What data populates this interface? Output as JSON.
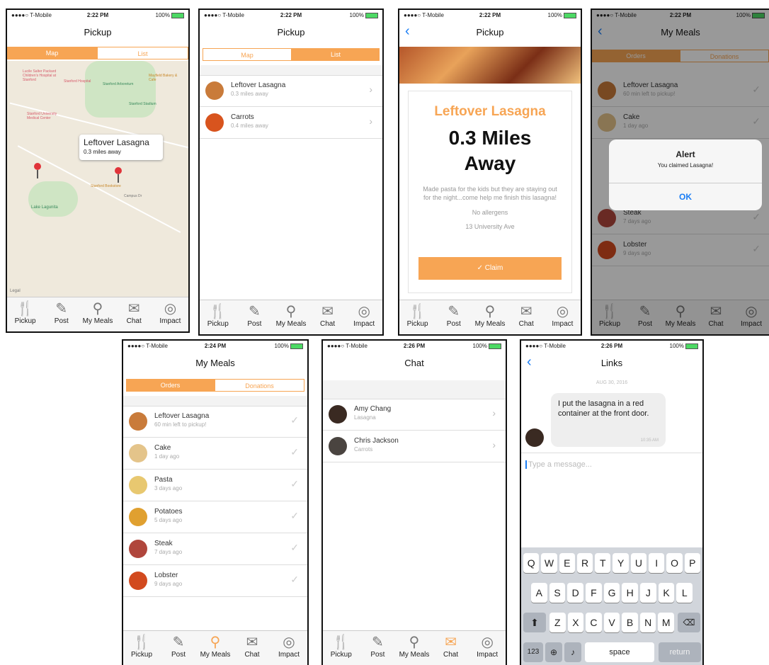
{
  "status": {
    "carrier": "●●●●○ T-Mobile",
    "battery": "100%"
  },
  "tabs": [
    "Pickup",
    "Post",
    "My Meals",
    "Chat",
    "Impact"
  ],
  "s1": {
    "time": "2:22 PM",
    "title": "Pickup",
    "seg_map": "Map",
    "seg_list": "List",
    "popup_title": "Leftover Lasagna",
    "popup_sub": "0.3 miles away",
    "labels": [
      "Lucile Salter Packard Children's Hospital at Stanford",
      "Stanford Hospital",
      "Stanford Arboretum",
      "Stanford Stadium",
      "Stanford University Medical Center",
      "Stanford Bookstore",
      "Lake Lagunita",
      "Mayfield Bakery & Cafe",
      "Campus Dr",
      "Legal"
    ]
  },
  "s2": {
    "time": "2:22 PM",
    "title": "Pickup",
    "seg_map": "Map",
    "seg_list": "List",
    "items": [
      {
        "name": "Leftover Lasagna",
        "sub": "0.3 miles away"
      },
      {
        "name": "Carrots",
        "sub": "0.4 miles away"
      }
    ]
  },
  "s3": {
    "time": "2:22 PM",
    "title": "Pickup",
    "dish": "Leftover Lasagna",
    "distance_line1": "0.3 Miles",
    "distance_line2": "Away",
    "desc": "Made pasta for the kids but they are staying out for the night...come help me finish this lasagna!",
    "allergens": "No allergens",
    "address": "13 University Ave",
    "claim": "✓ Claim"
  },
  "s4": {
    "time": "2:22 PM",
    "title": "My Meals",
    "seg_a": "Orders",
    "seg_b": "Donations",
    "items": [
      {
        "name": "Leftover Lasagna",
        "sub": "60 min left to pickup!"
      },
      {
        "name": "Cake",
        "sub": "1 day ago"
      },
      {
        "name": "Steak",
        "sub": "7 days ago"
      },
      {
        "name": "Lobster",
        "sub": "9 days ago"
      }
    ],
    "alert_title": "Alert",
    "alert_msg": "You claimed Lasagna!",
    "alert_ok": "OK"
  },
  "s5": {
    "time": "2:24 PM",
    "title": "My Meals",
    "seg_a": "Orders",
    "seg_b": "Donations",
    "items": [
      {
        "name": "Leftover Lasagna",
        "sub": "60 min left to pickup!"
      },
      {
        "name": "Cake",
        "sub": "1 day ago"
      },
      {
        "name": "Pasta",
        "sub": "3 days ago"
      },
      {
        "name": "Potatoes",
        "sub": "5 days ago"
      },
      {
        "name": "Steak",
        "sub": "7 days ago"
      },
      {
        "name": "Lobster",
        "sub": "9 days ago"
      }
    ]
  },
  "s6": {
    "time": "2:26 PM",
    "title": "Chat",
    "items": [
      {
        "name": "Amy Chang",
        "sub": "Lasagna"
      },
      {
        "name": "Chris Jackson",
        "sub": "Carrots"
      }
    ]
  },
  "s7": {
    "time": "2:26 PM",
    "title": "Links",
    "date": "AUG 30, 2016",
    "message": "I put the lasagna in a red container at the front door.",
    "msg_time": "10:35 AM",
    "placeholder": "Type a message...",
    "keys_row1": [
      "Q",
      "W",
      "E",
      "R",
      "T",
      "Y",
      "U",
      "I",
      "O",
      "P"
    ],
    "keys_row2": [
      "A",
      "S",
      "D",
      "F",
      "G",
      "H",
      "J",
      "K",
      "L"
    ],
    "keys_row3": [
      "Z",
      "X",
      "C",
      "V",
      "B",
      "N",
      "M"
    ],
    "key_123": "123",
    "key_space": "space",
    "key_return": "return"
  },
  "colors": {
    "accent": "#f7a554",
    "ios_blue": "#1b7ef5"
  },
  "icons": [
    "fork-knife-icon",
    "pencil-icon",
    "location-pin-icon",
    "envelope-icon",
    "target-icon"
  ]
}
